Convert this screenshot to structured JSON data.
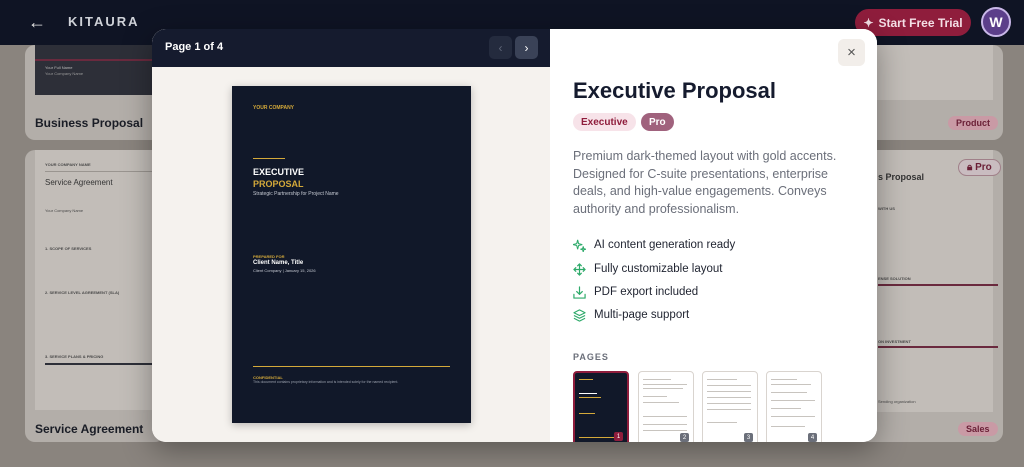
{
  "app": {
    "logo": "KITAURA",
    "trial_button": "Start Free Trial",
    "avatar_initial": "W"
  },
  "background_cards": [
    {
      "title": "Business Proposal",
      "badge": ""
    },
    {
      "title": "Service Agreement",
      "badge": ""
    },
    {
      "title": "",
      "badge": "Product"
    },
    {
      "title": "s Proposal",
      "badge": "Sales",
      "pro_label": "Pro"
    }
  ],
  "background_snippets": {
    "card1_name": "Your Full Name",
    "card1_company": "Your Company Name",
    "card2_header": "YOUR COMPANY NAME",
    "card2_title": "Service Agreement",
    "card2_company": "Your Company Name",
    "card2_s1": "1. SCOPE OF SERVICES",
    "card2_s2": "2. SERVICE LEVEL AGREEMENT (SLA)",
    "card2_s3": "3. SERVICE PLANS & PRICING",
    "card4_with": "WITH US",
    "card4_solution": "ENSE SOLUTION",
    "card4_invest": "ON INVESTMENT",
    "card4_org": "Sending organization"
  },
  "modal": {
    "page_indicator": "Page 1 of 4",
    "prev_icon": "‹",
    "next_icon": "›",
    "close_icon": "×",
    "document": {
      "company": "YOUR COMPANY",
      "title_line1": "EXECUTIVE",
      "title_line2": "PROPOSAL",
      "subtitle": "Strategic Partnership for Project Name",
      "prepared_for": "PREPARED FOR",
      "client": "Client Name, Title",
      "client_meta": "Client Company  |  January 15, 2026",
      "confidential": "CONFIDENTIAL",
      "confidential_note": "This document contains proprietary information and is intended solely for the named recipient."
    },
    "title": "Executive Proposal",
    "tags": [
      "Executive",
      "Pro"
    ],
    "description": "Premium dark-themed layout with gold accents. Designed for C-suite presentations, enterprise deals, and high-value engagements. Conveys authority and professionalism.",
    "features": [
      {
        "icon": "sparkles-icon",
        "label": "AI content generation ready"
      },
      {
        "icon": "move-icon",
        "label": "Fully customizable layout"
      },
      {
        "icon": "download-icon",
        "label": "PDF export included"
      },
      {
        "icon": "layers-icon",
        "label": "Multi-page support"
      }
    ],
    "pages_label": "PAGES",
    "pages": [
      "1",
      "2",
      "3",
      "4"
    ]
  }
}
